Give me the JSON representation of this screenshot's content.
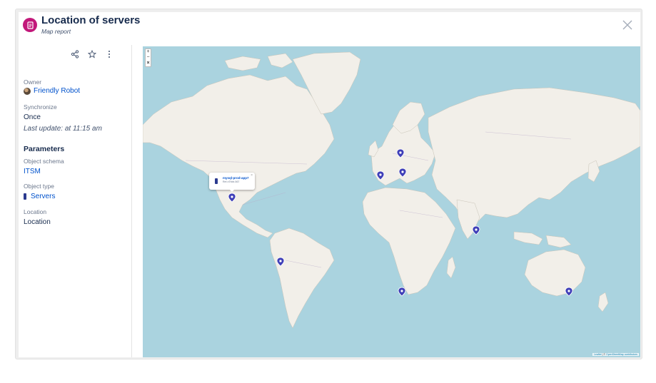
{
  "header": {
    "title": "Location of servers",
    "subtitle": "Map report",
    "icon": "report-icon",
    "accent": "#c2187a"
  },
  "sidebar": {
    "actions": [
      "share-icon",
      "star-icon",
      "more-icon"
    ],
    "owner_label": "Owner",
    "owner_name": "Friendly Robot",
    "sync_label": "Synchronize",
    "sync_value": "Once",
    "last_update": "Last update: at 11:15 am",
    "parameters_heading": "Parameters",
    "schema_label": "Object schema",
    "schema_value": "ITSM",
    "type_label": "Object type",
    "type_value": "Servers",
    "location_label": "Location",
    "location_value": "Location"
  },
  "map": {
    "zoom_in": "+",
    "zoom_out": "−",
    "zoom_close": "×",
    "popup_name": "mysql-prod-app7",
    "popup_desc": "Ref-n7hbb-567",
    "popup_close": "×",
    "attribution_prefix": "Leaflet",
    "attribution_sep": " | © ",
    "attribution_link": "OpenStreetMap contributors",
    "pin_color": "#3f3fb8",
    "water_color": "#aad3df",
    "land_color": "#f2efe9"
  }
}
